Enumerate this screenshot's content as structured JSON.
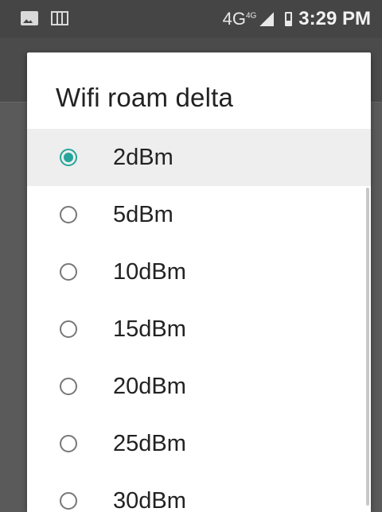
{
  "status_bar": {
    "network": "4G",
    "network_sup": "4G",
    "time": "3:29 PM"
  },
  "dialog": {
    "title": "Wifi roam delta",
    "selected_index": 0,
    "options": [
      {
        "label": "2dBm"
      },
      {
        "label": "5dBm"
      },
      {
        "label": "10dBm"
      },
      {
        "label": "15dBm"
      },
      {
        "label": "20dBm"
      },
      {
        "label": "25dBm"
      },
      {
        "label": "30dBm"
      }
    ]
  },
  "colors": {
    "accent": "#26a69a",
    "status_bar_bg": "#454545",
    "dialog_bg": "#ffffff",
    "selected_row_bg": "#eeeeee"
  },
  "icons": {
    "status_left": [
      "image-notification-icon",
      "sim-card-icon"
    ],
    "status_right": [
      "signal-strength-icon",
      "battery-icon"
    ]
  }
}
